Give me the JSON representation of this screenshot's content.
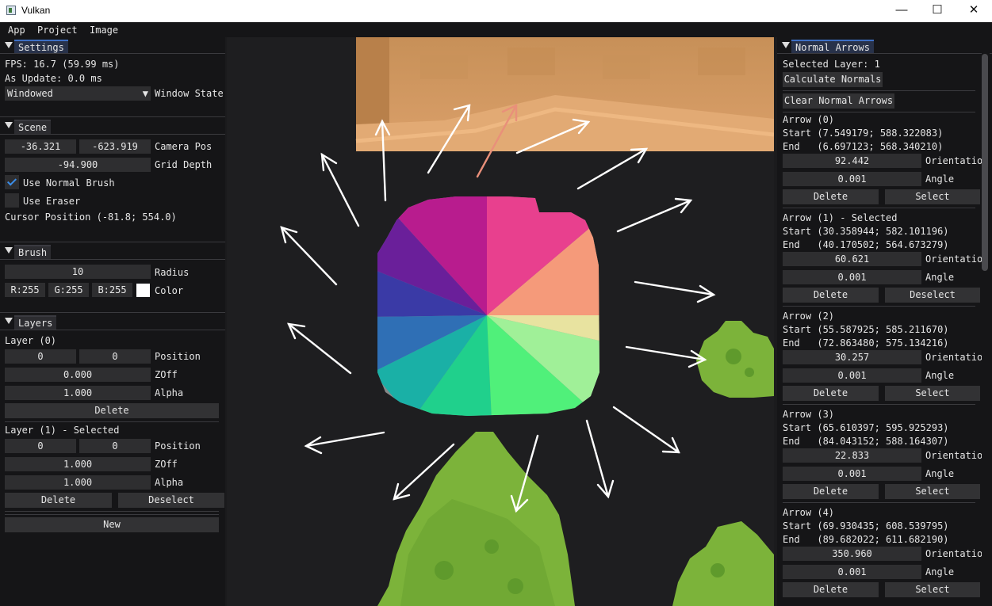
{
  "window": {
    "title": "Vulkan",
    "minimize": "—",
    "maximize": "☐",
    "close": "✕"
  },
  "menu": [
    "App",
    "Project",
    "Image"
  ],
  "settings": {
    "header": "Settings",
    "fps": "FPS: 16.7 (59.99 ms)",
    "as_update": "As Update: 0.0 ms",
    "window_state_value": "Windowed",
    "window_state_label": "Window State"
  },
  "scene": {
    "header": "Scene",
    "cam_x": "-36.321",
    "cam_y": "-623.919",
    "camera_pos_label": "Camera Pos",
    "grid_depth": "-94.900",
    "grid_depth_label": "Grid Depth",
    "use_normal_brush": "Use Normal Brush",
    "use_normal_brush_checked": true,
    "use_eraser": "Use Eraser",
    "use_eraser_checked": false,
    "cursor": "Cursor Position (-81.8; 554.0)"
  },
  "brush": {
    "header": "Brush",
    "radius": "10",
    "radius_label": "Radius",
    "r": "R:255",
    "g": "G:255",
    "b": "B:255",
    "color_label": "Color",
    "color": "#ffffff"
  },
  "layers": {
    "header": "Layers",
    "list": [
      {
        "title": "Layer (0)",
        "pos_x": "0",
        "pos_y": "0",
        "position_label": "Position",
        "zoff": "0.000",
        "zoff_label": "ZOff",
        "alpha": "1.000",
        "alpha_label": "Alpha",
        "delete": "Delete"
      },
      {
        "title": "Layer (1) - Selected",
        "pos_x": "0",
        "pos_y": "0",
        "position_label": "Position",
        "zoff": "1.000",
        "zoff_label": "ZOff",
        "alpha": "1.000",
        "alpha_label": "Alpha",
        "delete": "Delete",
        "deselect": "Deselect"
      }
    ],
    "new": "New"
  },
  "normal_arrows": {
    "header": "Normal Arrows",
    "selected_layer": "Selected Layer: 1",
    "calculate": "Calculate Normals",
    "clear": "Clear Normal Arrows",
    "arrows": [
      {
        "title": "Arrow (0)",
        "start": "Start (7.549179; 588.322083)",
        "end": "End   (6.697123; 568.340210)",
        "orientation": "92.442",
        "orientation_label": "Orientatio",
        "angle": "0.001",
        "angle_label": "Angle",
        "delete": "Delete",
        "select": "Select"
      },
      {
        "title": "Arrow (1) - Selected",
        "start": "Start (30.358944; 582.101196)",
        "end": "End   (40.170502; 564.673279)",
        "orientation": "60.621",
        "orientation_label": "Orientatio",
        "angle": "0.001",
        "angle_label": "Angle",
        "delete": "Delete",
        "select": "Deselect"
      },
      {
        "title": "Arrow (2)",
        "start": "Start (55.587925; 585.211670)",
        "end": "End   (72.863480; 575.134216)",
        "orientation": "30.257",
        "orientation_label": "Orientatio",
        "angle": "0.001",
        "angle_label": "Angle",
        "delete": "Delete",
        "select": "Select"
      },
      {
        "title": "Arrow (3)",
        "start": "Start (65.610397; 595.925293)",
        "end": "End   (84.043152; 588.164307)",
        "orientation": "22.833",
        "orientation_label": "Orientatio",
        "angle": "0.001",
        "angle_label": "Angle",
        "delete": "Delete",
        "select": "Select"
      },
      {
        "title": "Arrow (4)",
        "start": "Start (69.930435; 608.539795)",
        "end": "End   (89.682022; 611.682190)",
        "orientation": "350.960",
        "orientation_label": "Orientatio",
        "angle": "0.001",
        "angle_label": "Angle",
        "delete": "Delete",
        "select": "Select"
      }
    ]
  },
  "colors": {
    "background": "#1e1e20",
    "panel": "#151517",
    "field": "#2e2e30",
    "button": "#323234",
    "active_tab": "#3d6fc4",
    "checkmark": "#3b8eea",
    "sand": "#d8a068",
    "grass": "#7cb33a",
    "grass_dark": "#5f9a2c",
    "selected_arrow": "#e9907a"
  },
  "canvas": {
    "icons": [
      "sand-tile-sprite",
      "normal-color-wheel",
      "grass-bush-sprite",
      "normal-arrow-icon"
    ]
  }
}
